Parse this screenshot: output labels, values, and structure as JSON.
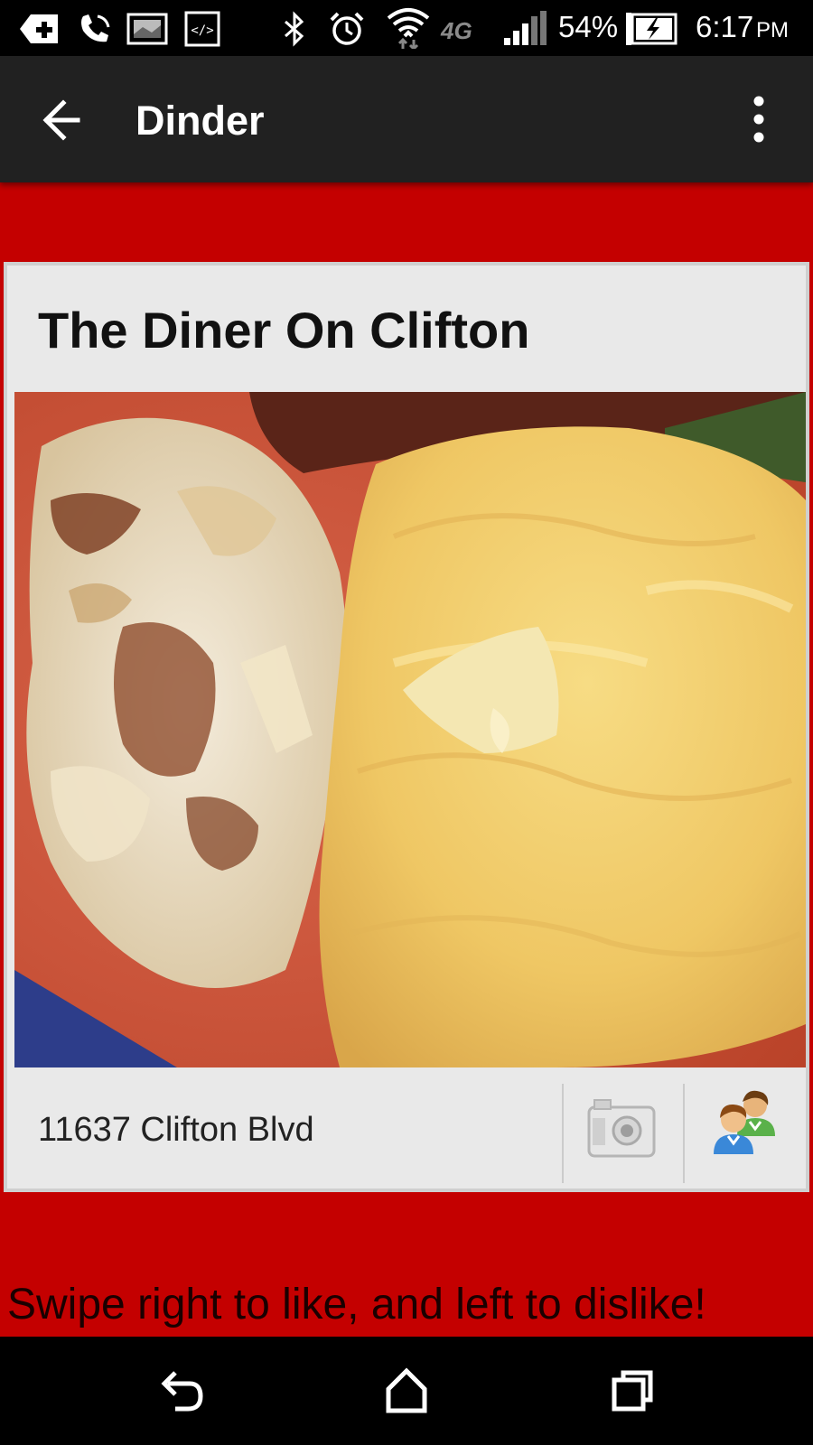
{
  "status_bar": {
    "battery": "54%",
    "time": "6:17",
    "ampm": "PM",
    "network": "4G"
  },
  "action_bar": {
    "title": "Dinder"
  },
  "card": {
    "title": "The Diner On Clifton",
    "photo": "omelette-and-home-fries",
    "address": "11637 Clifton Blvd"
  },
  "hint": "Swipe right to like, and left to dislike!",
  "colors": {
    "background": "#c40000",
    "action_bar": "#212121",
    "card": "#e9e9e9"
  }
}
